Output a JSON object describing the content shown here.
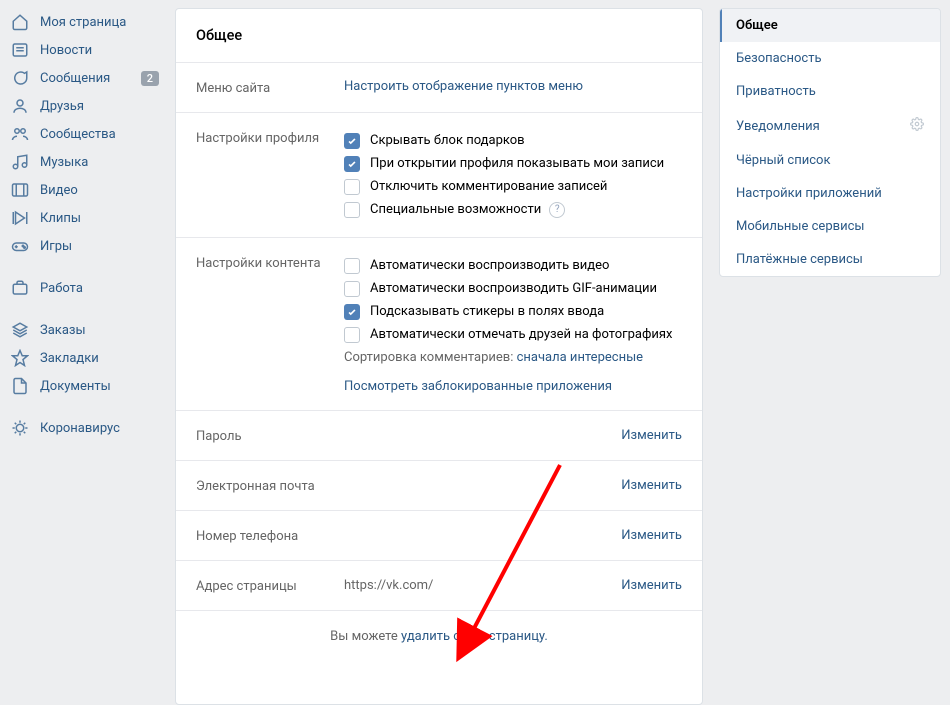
{
  "left_nav": {
    "items": [
      {
        "label": "Моя страница",
        "icon": "home"
      },
      {
        "label": "Новости",
        "icon": "news"
      },
      {
        "label": "Сообщения",
        "icon": "messages",
        "badge": "2"
      },
      {
        "label": "Друзья",
        "icon": "friends"
      },
      {
        "label": "Сообщества",
        "icon": "groups"
      },
      {
        "label": "Музыка",
        "icon": "music"
      },
      {
        "label": "Видео",
        "icon": "video"
      },
      {
        "label": "Клипы",
        "icon": "clips"
      },
      {
        "label": "Игры",
        "icon": "games"
      }
    ],
    "items2": [
      {
        "label": "Работа",
        "icon": "work"
      }
    ],
    "items3": [
      {
        "label": "Заказы",
        "icon": "orders"
      },
      {
        "label": "Закладки",
        "icon": "bookmark"
      },
      {
        "label": "Документы",
        "icon": "docs"
      }
    ],
    "items4": [
      {
        "label": "Коронавирус",
        "icon": "covid"
      }
    ]
  },
  "main": {
    "title": "Общее",
    "site_menu": {
      "label": "Меню сайта",
      "link": "Настроить отображение пунктов меню"
    },
    "profile": {
      "label": "Настройки профиля",
      "opts": [
        {
          "label": "Скрывать блок подарков",
          "checked": true
        },
        {
          "label": "При открытии профиля показывать мои записи",
          "checked": true
        },
        {
          "label": "Отключить комментирование записей",
          "checked": false
        },
        {
          "label": "Специальные возможности",
          "checked": false,
          "help": true
        }
      ]
    },
    "content": {
      "label": "Настройки контента",
      "opts": [
        {
          "label": "Автоматически воспроизводить видео",
          "checked": false
        },
        {
          "label": "Автоматически воспроизводить GIF-анимации",
          "checked": false
        },
        {
          "label": "Подсказывать стикеры в полях ввода",
          "checked": true
        },
        {
          "label": "Автоматически отмечать друзей на фотографиях",
          "checked": false
        }
      ],
      "sort_label": "Сортировка комментариев: ",
      "sort_value": "сначала интересные",
      "blocked_link": "Посмотреть заблокированные приложения"
    },
    "rows": [
      {
        "label": "Пароль",
        "value": "",
        "action": "Изменить"
      },
      {
        "label": "Электронная почта",
        "value": "",
        "action": "Изменить"
      },
      {
        "label": "Номер телефона",
        "value": "",
        "action": "Изменить"
      },
      {
        "label": "Адрес страницы",
        "value": "https://vk.com/",
        "action": "Изменить"
      }
    ],
    "footer": {
      "prefix": "Вы можете ",
      "link": "удалить свою страницу."
    }
  },
  "right_nav": {
    "items": [
      {
        "label": "Общее",
        "active": true
      },
      {
        "label": "Безопасность"
      },
      {
        "label": "Приватность"
      },
      {
        "label": "Уведомления",
        "gear": true
      },
      {
        "label": "Чёрный список"
      },
      {
        "label": "Настройки приложений"
      },
      {
        "label": "Мобильные сервисы"
      },
      {
        "label": "Платёжные сервисы"
      }
    ]
  }
}
